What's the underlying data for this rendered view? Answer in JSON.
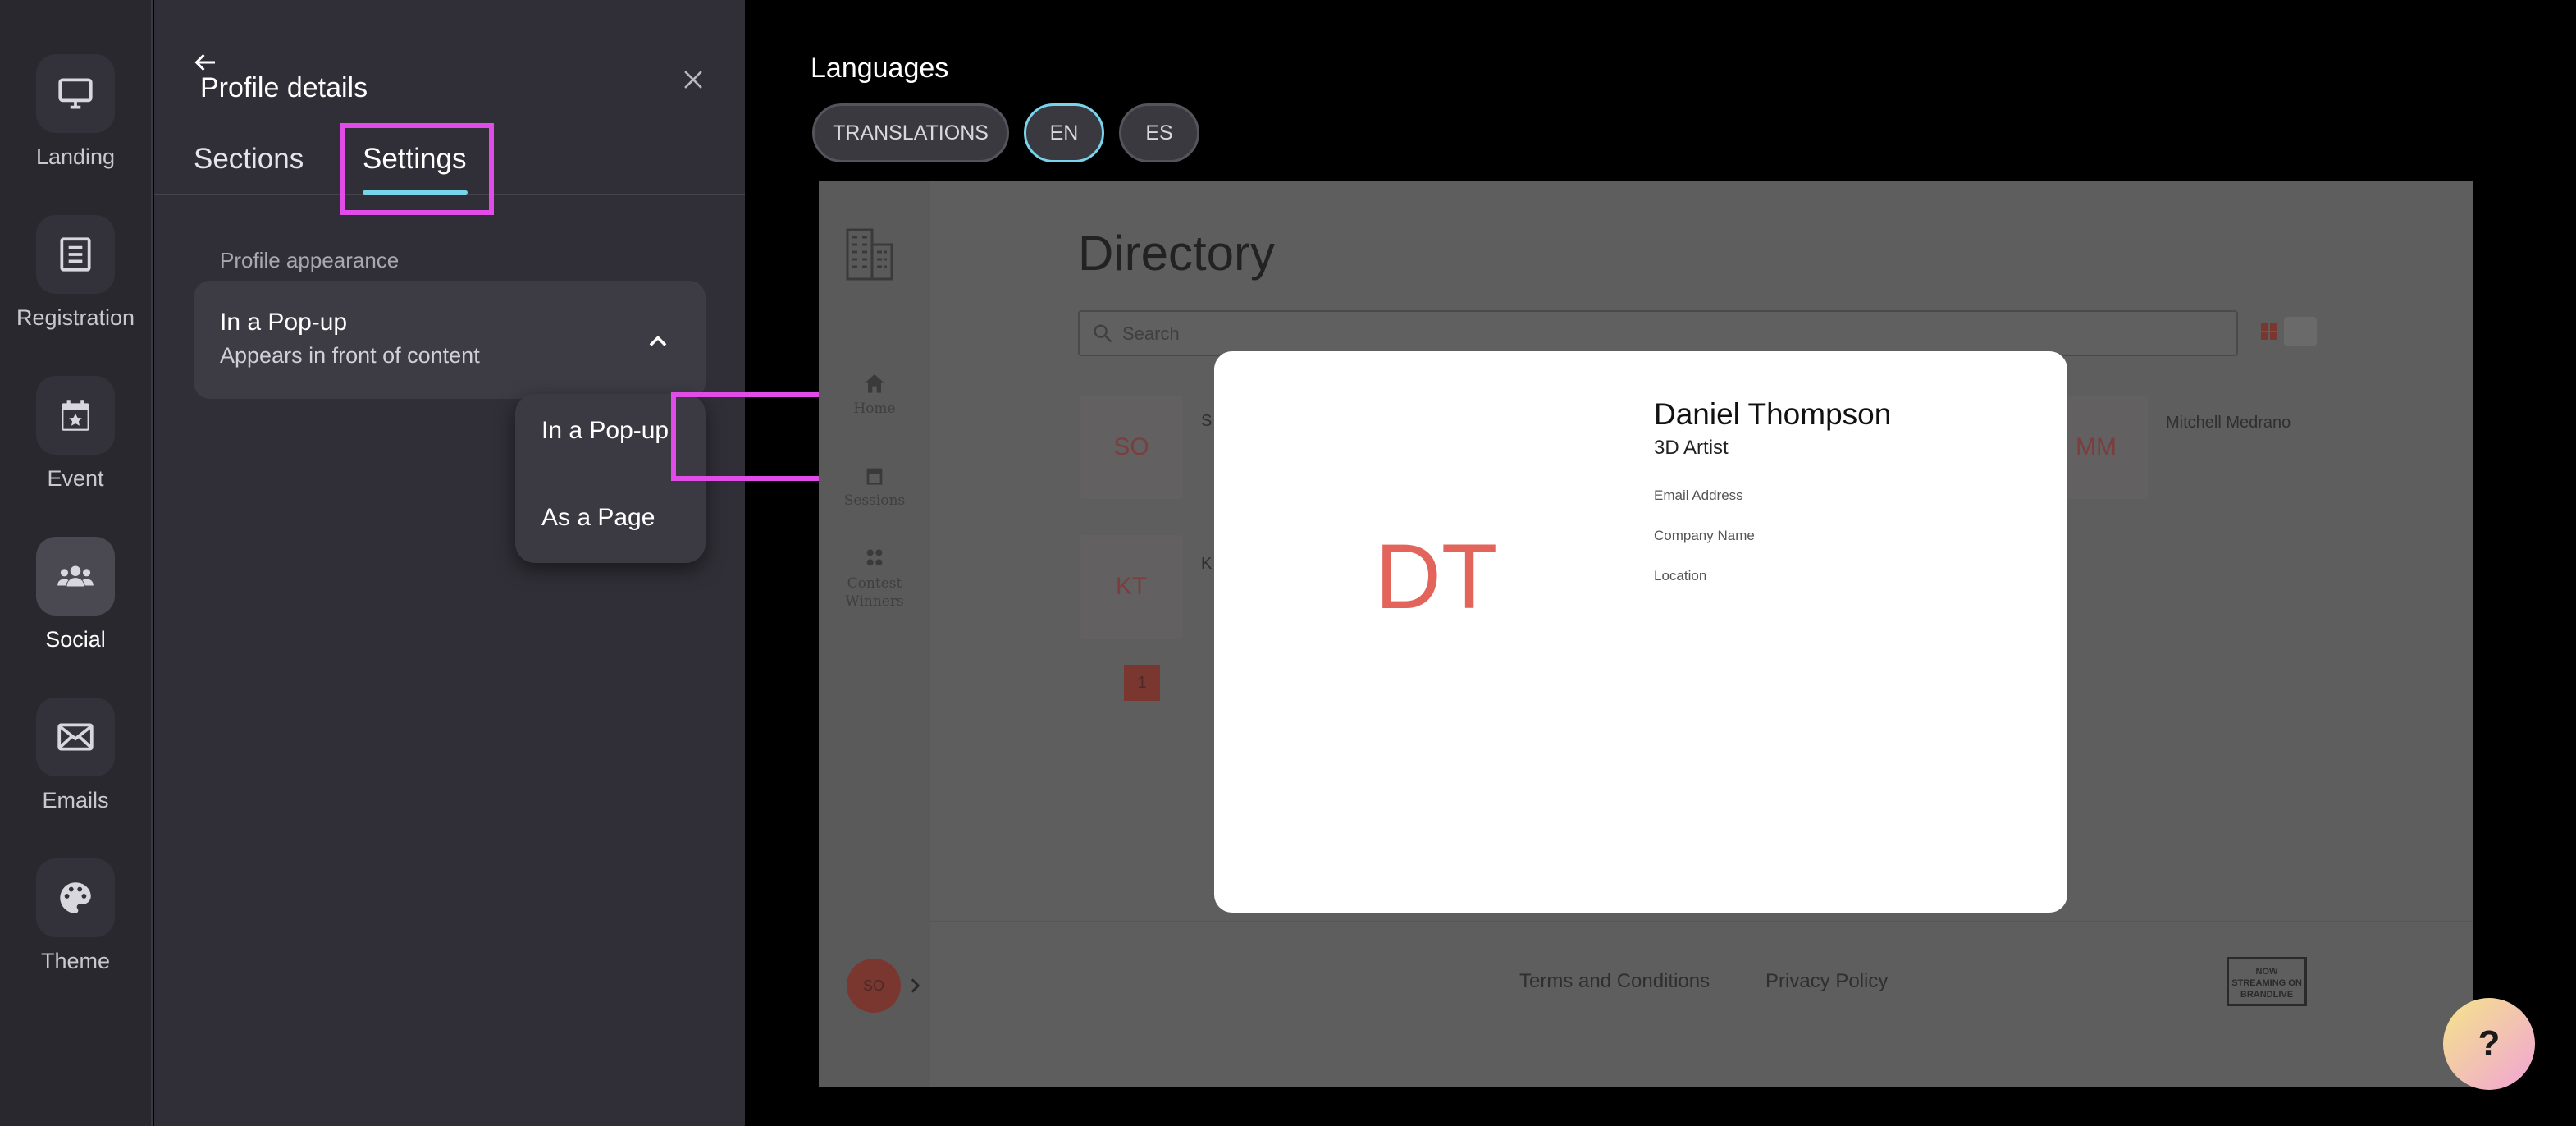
{
  "rail": {
    "items": [
      {
        "label": "Landing",
        "icon": "monitor-icon"
      },
      {
        "label": "Registration",
        "icon": "list-icon"
      },
      {
        "label": "Event",
        "icon": "calendar-icon"
      },
      {
        "label": "Social",
        "icon": "people-icon",
        "active": true
      },
      {
        "label": "Emails",
        "icon": "envelope-icon"
      },
      {
        "label": "Theme",
        "icon": "palette-icon"
      }
    ]
  },
  "panel": {
    "title": "Profile details",
    "tabs": [
      {
        "label": "Sections"
      },
      {
        "label": "Settings",
        "active": true
      }
    ],
    "section_label": "Profile appearance",
    "select": {
      "value": "In a Pop-up",
      "description": "Appears in front of content"
    },
    "dropdown": {
      "options": [
        "In a Pop-up",
        "As a Page"
      ]
    }
  },
  "languages": {
    "title": "Languages",
    "buttons": [
      "TRANSLATIONS",
      "EN",
      "ES"
    ],
    "selected": "EN"
  },
  "preview": {
    "heading": "Directory",
    "search_placeholder": "Search",
    "nav": [
      "Home",
      "Sessions",
      "Contest Winners"
    ],
    "cards": [
      {
        "initials": "SO",
        "name": "S"
      },
      {
        "initials": "MM",
        "name": "Mitchell Medrano"
      },
      {
        "initials": "KT",
        "name": "K"
      }
    ],
    "pagination": {
      "current": "1"
    },
    "footer": {
      "avatar_initials": "SO",
      "links": [
        "Terms and Conditions",
        "Privacy Policy"
      ],
      "logo_text": "NOW STREAMING ON BRANDLIVE"
    },
    "modal": {
      "initials": "DT",
      "name": "Daniel Thompson",
      "role": "3D Artist",
      "fields": [
        "Email Address",
        "Company Name",
        "Location"
      ]
    }
  },
  "help": {
    "label": "?"
  },
  "colors": {
    "accent": "#77d4ea",
    "highlight": "#e14be8",
    "initials": "#e2645a"
  }
}
